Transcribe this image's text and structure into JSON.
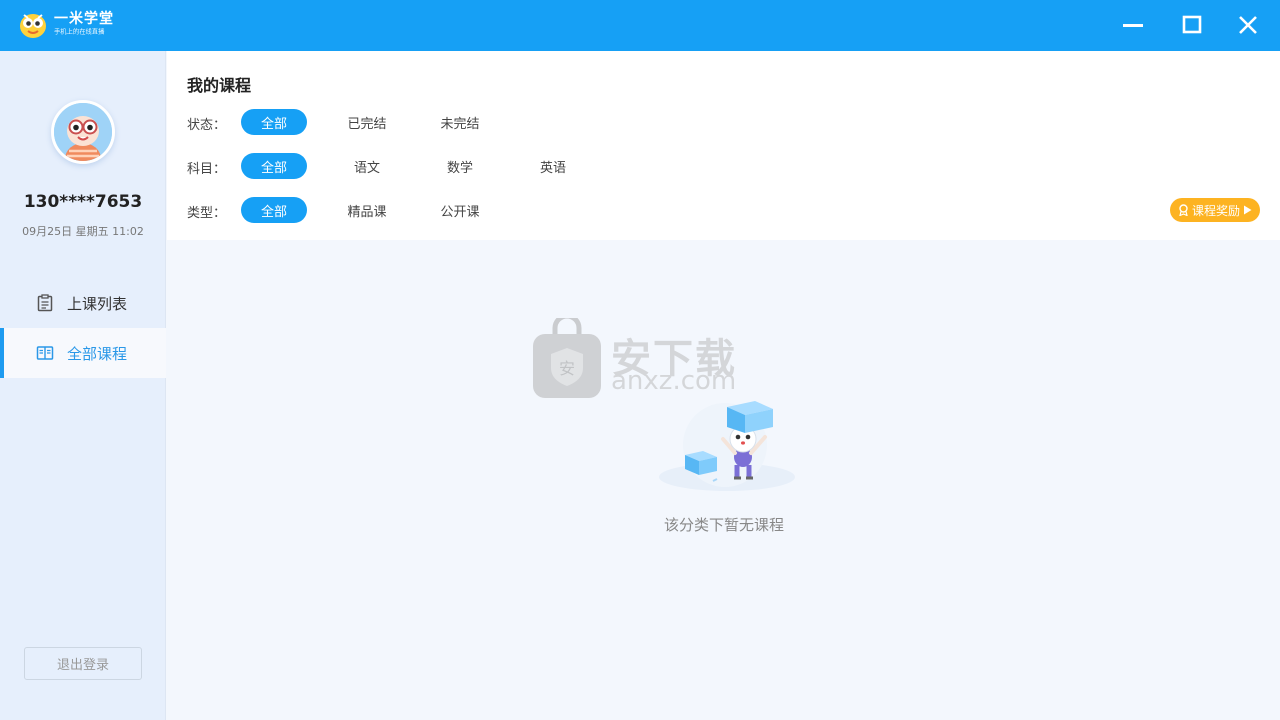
{
  "app": {
    "name": "一米学堂",
    "slogan": "手机上的在线直播"
  },
  "window_controls": {
    "minimize": "minimize-icon",
    "maximize": "maximize-icon",
    "close": "close-icon"
  },
  "user": {
    "phone": "130****7653",
    "datetime": "09月25日 星期五 11:02"
  },
  "sidebar": {
    "items": [
      {
        "label": "上课列表",
        "icon": "clipboard-list-icon",
        "active": false
      },
      {
        "label": "全部课程",
        "icon": "book-open-icon",
        "active": true
      }
    ],
    "logout_label": "退出登录"
  },
  "main": {
    "title": "我的课程",
    "filters": {
      "status": {
        "label": "状态：",
        "options": [
          "全部",
          "已完结",
          "未完结"
        ],
        "selected": "全部"
      },
      "subject": {
        "label": "科目：",
        "options": [
          "全部",
          "语文",
          "数学",
          "英语"
        ],
        "selected": "全部"
      },
      "type": {
        "label": "类型：",
        "options": [
          "全部",
          "精品课",
          "公开课"
        ],
        "selected": "全部"
      }
    },
    "reward_button": "课程奖励",
    "empty_text": "该分类下暂无课程"
  },
  "watermark": {
    "text": "安下载",
    "sub": "anxz.com"
  },
  "colors": {
    "accent": "#16a0f5",
    "sidebar_bg": "#e6effc",
    "reward": "#fdb321"
  }
}
